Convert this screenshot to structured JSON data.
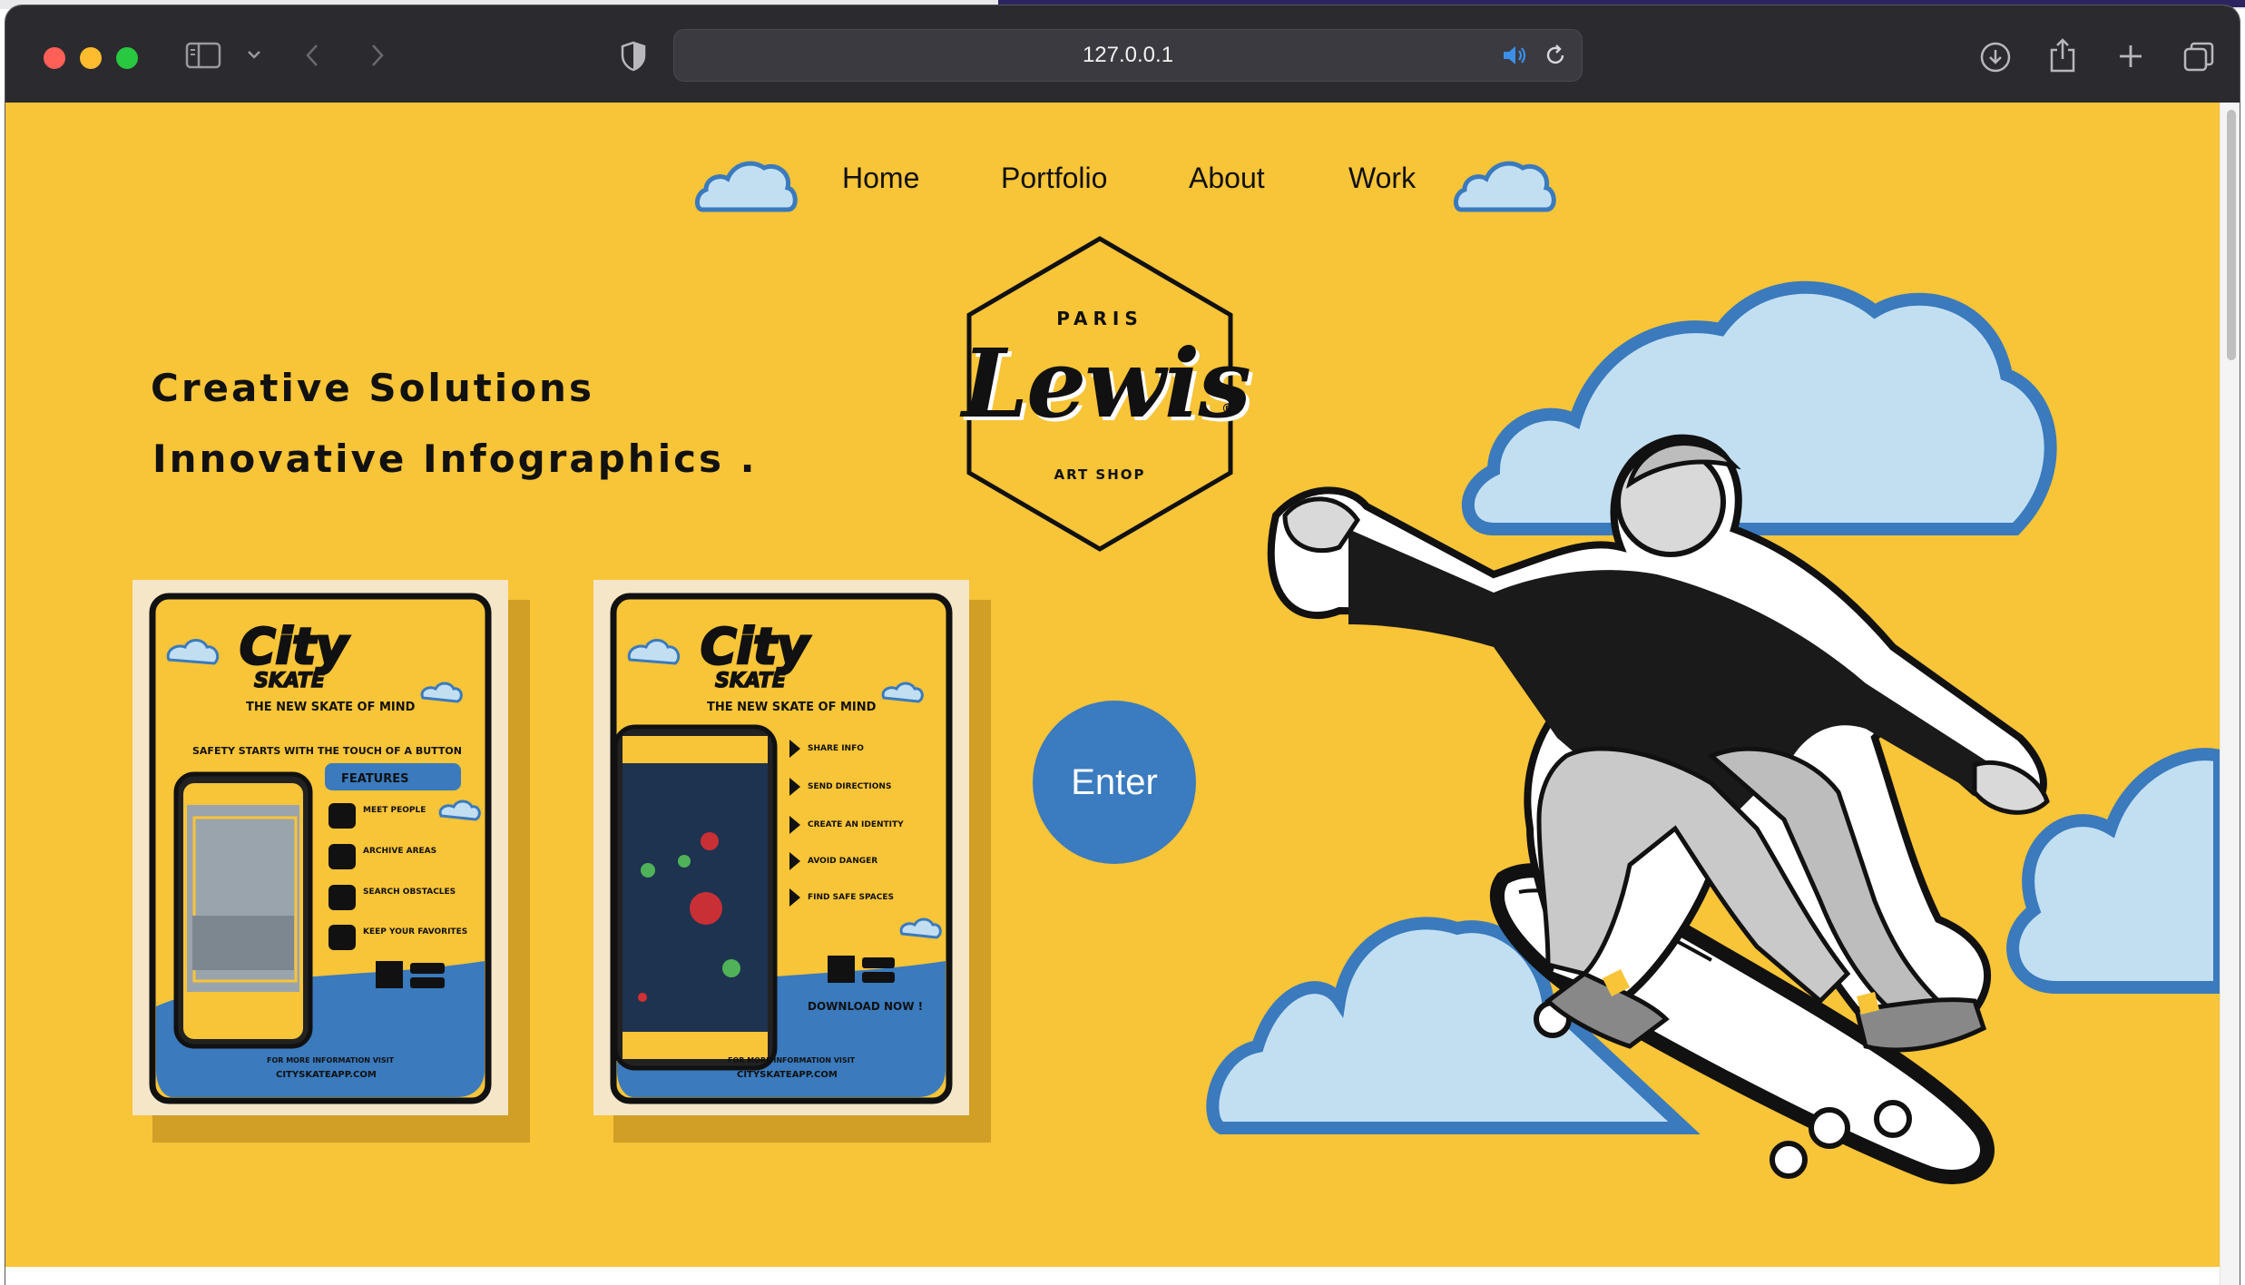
{
  "browser": {
    "url": "127.0.0.1"
  },
  "nav": {
    "items": [
      {
        "label": "Home"
      },
      {
        "label": "Portfolio"
      },
      {
        "label": "About"
      },
      {
        "label": "Work"
      }
    ]
  },
  "logo": {
    "city": "PARIS",
    "name": "Lewis",
    "subtitle": "ART SHOP",
    "mark": "®"
  },
  "hero": {
    "line1": "Creative Solutions",
    "line2": "Innovative Infographics ."
  },
  "posters": {
    "brand": "City",
    "brand_sub": "SKATE",
    "tagline": "THE NEW SKATE OF MIND",
    "poster1": {
      "heading": "SAFETY STARTS WITH THE TOUCH OF A BUTTON",
      "features_title": "FEATURES",
      "features": [
        "MEET PEOPLE",
        "ARCHIVE AREAS",
        "SEARCH OBSTACLES",
        "KEEP YOUR FAVORITES"
      ],
      "footer_line1": "FOR MORE INFORMATION VISIT",
      "footer_line2": "CITYSKATEAPP.COM"
    },
    "poster2": {
      "items": [
        "SHARE INFO",
        "SEND DIRECTIONS",
        "CREATE AN IDENTITY",
        "AVOID DANGER",
        "FIND SAFE SPACES"
      ],
      "download": "DOWNLOAD NOW !",
      "footer_line1": "FOR MORE INFORMATION VISIT",
      "footer_line2": "CITYSKATEAPP.COM"
    }
  },
  "enter_button": {
    "label": "Enter"
  },
  "colors": {
    "page_background": "#f8c438",
    "cloud_fill": "#c2dff2",
    "cloud_stroke": "#3a7abd",
    "enter_button": "#3b7bbf",
    "toolbar": "#2b2a2f"
  }
}
